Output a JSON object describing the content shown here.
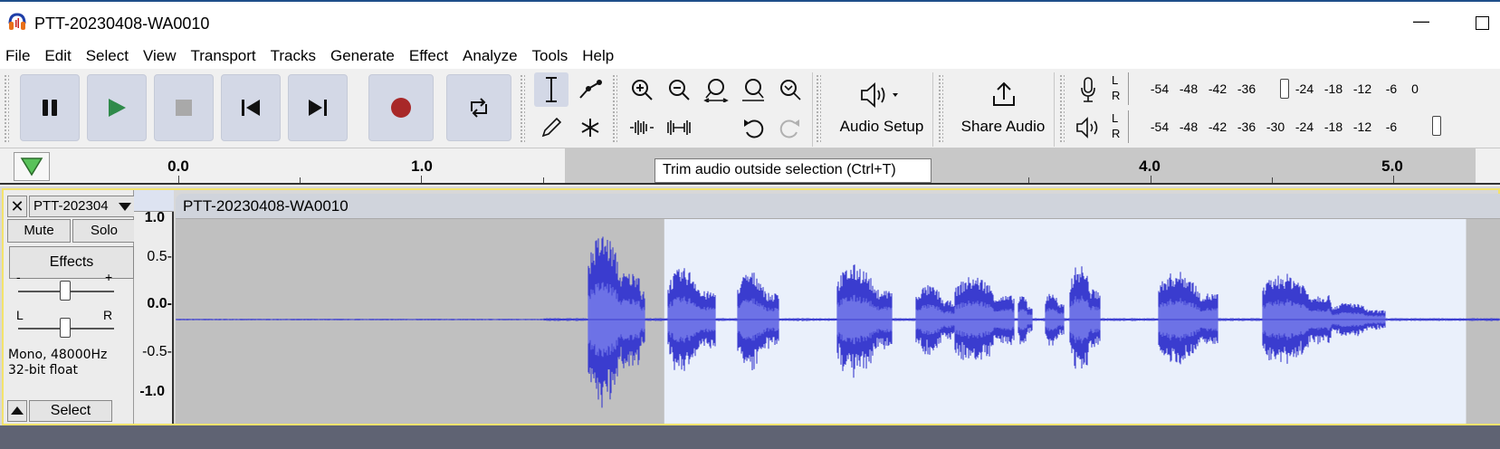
{
  "window": {
    "title": "PTT-20230408-WA0010",
    "minimize_glyph": "—"
  },
  "menu": [
    "File",
    "Edit",
    "Select",
    "View",
    "Transport",
    "Tracks",
    "Generate",
    "Effect",
    "Analyze",
    "Tools",
    "Help"
  ],
  "toolbar": {
    "audio_setup_label": "Audio Setup",
    "share_audio_label": "Share Audio",
    "meter_channels": [
      "L",
      "R"
    ],
    "meter_ticks": [
      "-54",
      "-48",
      "-42",
      "-36",
      "-30",
      "-24",
      "-18",
      "-12",
      "-6",
      "0"
    ]
  },
  "timeline": {
    "labels": [
      "0.0",
      "1.0",
      "4.0",
      "5.0"
    ],
    "selection_start_s": 2.0,
    "selection_end_s": 5.3
  },
  "tooltip": "Trim audio outside selection (Ctrl+T)",
  "track": {
    "close_glyph": "✕",
    "name_short": "PTT-202304",
    "name": "PTT-20230408-WA0010",
    "mute_label": "Mute",
    "solo_label": "Solo",
    "effects_label": "Effects",
    "gain_minus": "-",
    "gain_plus": "+",
    "pan_left": "L",
    "pan_right": "R",
    "info_line1": "Mono, 48000Hz",
    "info_line2": "32-bit float",
    "select_label": "Select",
    "vruler_labels": [
      "1.0",
      "0.5-",
      "0.0-",
      "-0.5-",
      "-1.0"
    ]
  }
}
